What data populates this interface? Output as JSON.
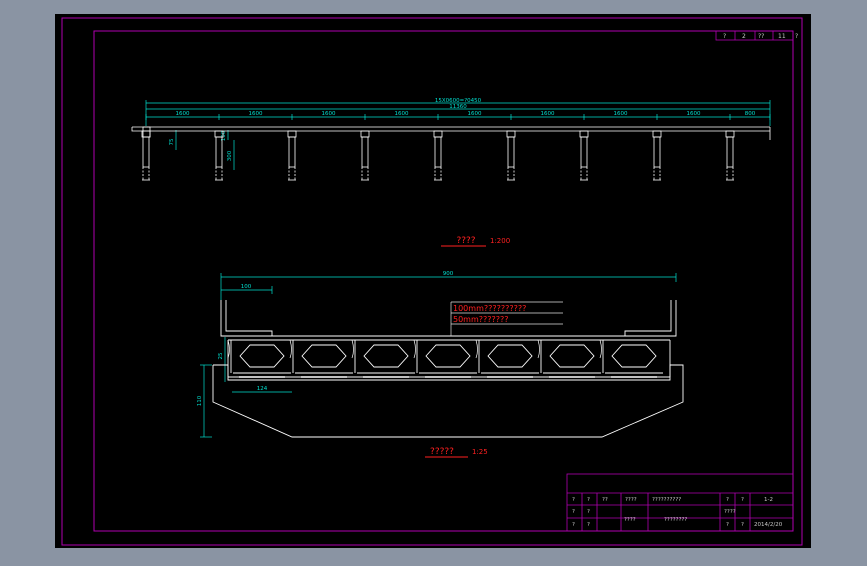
{
  "colors": {
    "background": "#8a94a3",
    "sheet": "#000000",
    "border": "#b000b0",
    "line": "#ffffff",
    "dimension": "#00e0d0",
    "accent": "#ff2020",
    "annotation_line": "#e0e0e0"
  },
  "frame_label": {
    "c1": "?",
    "c2": "2",
    "c3": "??",
    "c4": "11"
  },
  "elevation": {
    "total_top": "15X0600=?0450",
    "total_inner": "11360",
    "spans": [
      "1600",
      "1600",
      "1600",
      "1600",
      "1600",
      "1600",
      "1600",
      "1600",
      "800"
    ],
    "dim_deck": "75",
    "dim_pier_a": "100",
    "dim_pier_b": "300",
    "title": "????",
    "scale": "1:200"
  },
  "section": {
    "width_total": "900",
    "cantilever": "100",
    "note1": "100mm??????????",
    "note2": "50mm???????",
    "dim_slab": "25",
    "dim_abut": "110",
    "dim_bottom": "124",
    "title": "?????",
    "scale": "1:25"
  },
  "title_block": {
    "r1c1": "?",
    "r1c2": "?",
    "r1c3": "??",
    "r1c4": "????",
    "r1c5": "??????????",
    "r1c6": "?",
    "r1c7": "?",
    "r1c8": "1-2",
    "r2c1": "?",
    "r2c2": "?",
    "r2c6": "????",
    "r3c1": "?",
    "r3c2": "?",
    "r3c4": "????",
    "r3c5": "????????",
    "r3c6": "?",
    "r3c7": "?",
    "r3c8": "2014/2/20"
  }
}
